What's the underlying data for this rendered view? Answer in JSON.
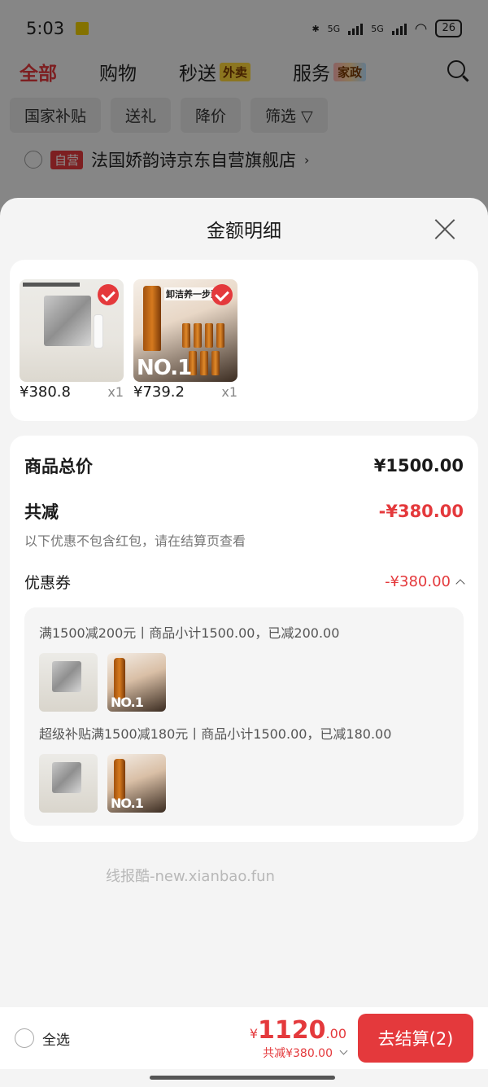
{
  "status": {
    "time": "5:03",
    "network_1": "5G",
    "network_2": "5G",
    "battery": "26"
  },
  "top_tabs": [
    {
      "label": "全部",
      "badge": ""
    },
    {
      "label": "购物",
      "badge": ""
    },
    {
      "label": "秒送",
      "badge": "外卖"
    },
    {
      "label": "服务",
      "badge": "家政"
    }
  ],
  "chips": [
    "国家补贴",
    "送礼",
    "降价",
    "筛选"
  ],
  "store": {
    "tag": "自营",
    "name": "法国娇韵诗京东自营旗舰店"
  },
  "sheet": {
    "title": "金额明细",
    "products": [
      {
        "price": "¥380.8",
        "qty": "x1"
      },
      {
        "price": "¥739.2",
        "qty": "x1"
      }
    ],
    "product_art": {
      "no1": "NO.1",
      "oil_text": "卸洁养一步到位"
    },
    "total_label": "商品总价",
    "total_value": "¥1500.00",
    "discount_label": "共减",
    "discount_value": "-¥380.00",
    "discount_note": "以下优惠不包含红包，请在结算页查看",
    "coupon_label": "优惠券",
    "coupon_value": "-¥380.00",
    "coupons": [
      {
        "text": "满1500减200元丨商品小计1500.00，已减200.00"
      },
      {
        "text": "超级补贴满1500减180元丨商品小计1500.00，已减180.00"
      }
    ]
  },
  "watermark": "线报酷-new.xianbao.fun",
  "bottom_bar": {
    "select_all": "全选",
    "currency": "¥",
    "total_int": "1120",
    "total_dec": ".00",
    "saved": "共减¥380.00",
    "checkout": "去结算(2)"
  },
  "colors": {
    "accent": "#e4393c",
    "background": "#f4f4f4"
  }
}
